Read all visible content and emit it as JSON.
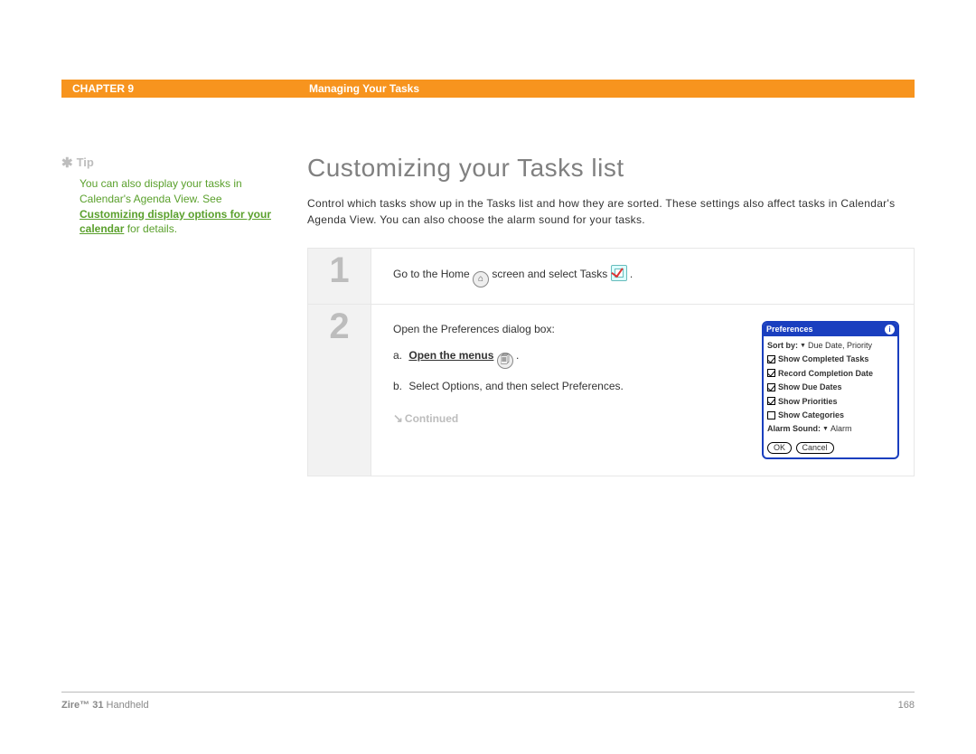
{
  "header": {
    "chapter": "CHAPTER 9",
    "title": "Managing Your Tasks"
  },
  "sidebar": {
    "tip_label": "Tip",
    "tip_line1": "You can also display your tasks in Calendar's Agenda View. See ",
    "tip_link": "Customizing display options for your calendar",
    "tip_line2": " for details."
  },
  "main": {
    "heading": "Customizing your Tasks list",
    "intro": "Control which tasks show up in the Tasks list and how they are sorted. These settings also affect tasks in Calendar's Agenda View. You can also choose the alarm sound for your tasks."
  },
  "steps": [
    {
      "num": "1",
      "line_a": "Go to the Home ",
      "line_b": " screen and select Tasks ",
      "line_c": " ."
    },
    {
      "num": "2",
      "lead": "Open the Preferences dialog box:",
      "a_prefix": "a.",
      "a_text": "Open the menus",
      "a_suffix": " .",
      "b_prefix": "b.",
      "b_text": "Select Options, and then select Preferences.",
      "continued": "Continued"
    }
  ],
  "prefs": {
    "title": "Preferences",
    "sortby_label": "Sort by:",
    "sortby_value": "Due Date, Priority",
    "rows": [
      {
        "checked": true,
        "label": "Show Completed Tasks"
      },
      {
        "checked": true,
        "label": "Record Completion Date"
      },
      {
        "checked": true,
        "label": "Show Due Dates"
      },
      {
        "checked": true,
        "label": "Show Priorities"
      },
      {
        "checked": false,
        "label": "Show Categories"
      }
    ],
    "alarm_label": "Alarm Sound:",
    "alarm_value": "Alarm",
    "ok": "OK",
    "cancel": "Cancel"
  },
  "footer": {
    "product_bold": "Zire™ 31",
    "product_rest": " Handheld",
    "page": "168"
  }
}
